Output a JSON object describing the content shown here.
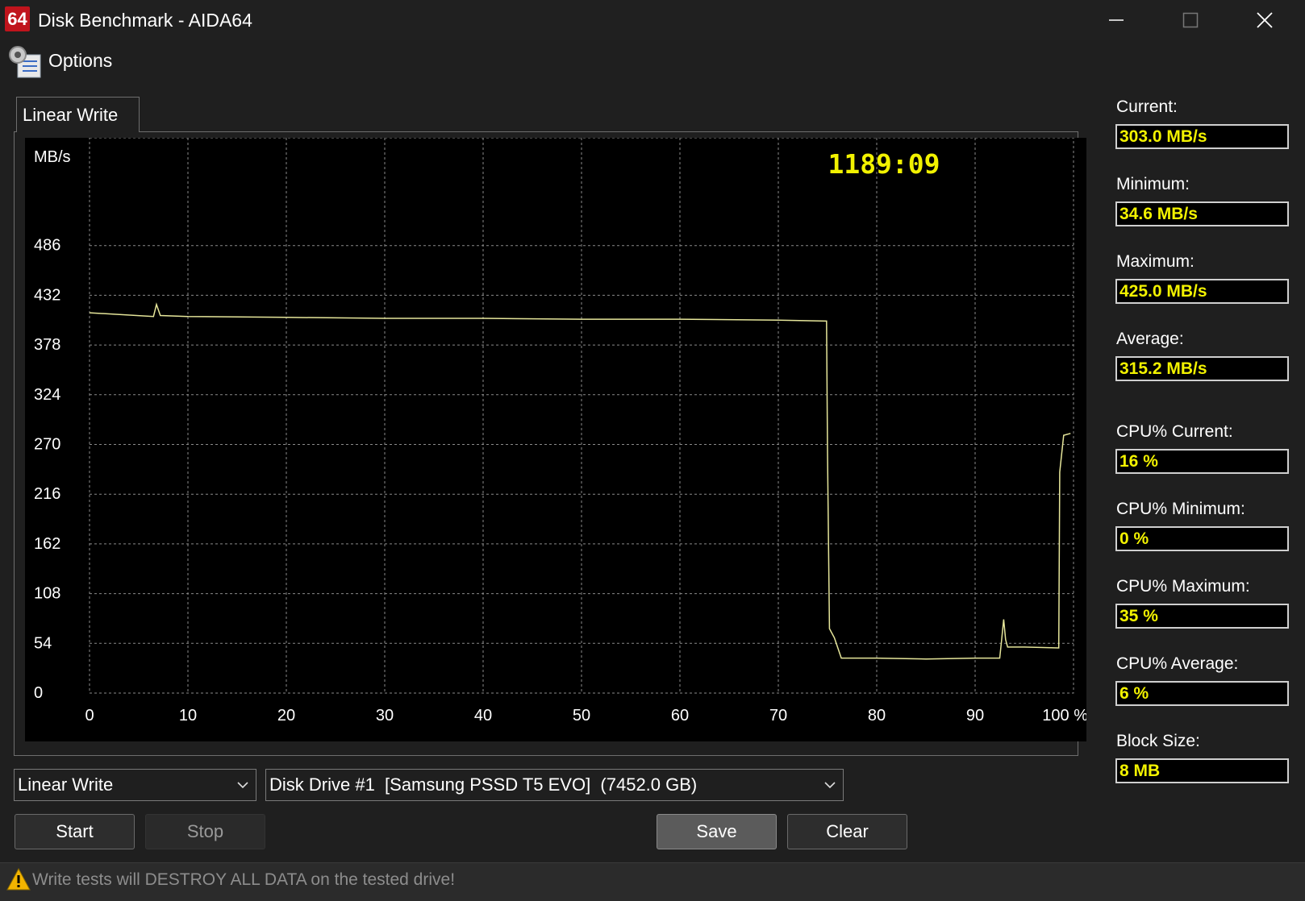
{
  "window": {
    "title": "Disk Benchmark - AIDA64",
    "logo_text": "64"
  },
  "menu": {
    "options_label": "Options"
  },
  "tabs": [
    {
      "label": "Linear Write"
    }
  ],
  "chart_data": {
    "type": "line",
    "ylabel": "MB/s",
    "y_ticks": [
      "486",
      "432",
      "378",
      "324",
      "270",
      "216",
      "162",
      "108",
      "54",
      "0"
    ],
    "x_ticks": [
      "0",
      "10",
      "20",
      "30",
      "40",
      "50",
      "60",
      "70",
      "80",
      "90",
      "100 %"
    ],
    "ylim": [
      0,
      540
    ],
    "xlim": [
      0,
      100
    ],
    "grid": true,
    "timer": "1189:09",
    "colors": {
      "background": "#000000",
      "grid": "#8a8a8a",
      "line": "#e6e69a",
      "timer": "#f2f200"
    },
    "series": [
      {
        "x": [
          0,
          6.5,
          6.8,
          7.2,
          10,
          20,
          30,
          40,
          50,
          60,
          70,
          74.9,
          75.0,
          75.2,
          75.7,
          76.4,
          80,
          85,
          90,
          92.5,
          92.7,
          92.9,
          93.1,
          93.3,
          95,
          98.5,
          98.6,
          99.0,
          99.7
        ],
        "y": [
          413,
          409,
          422,
          410,
          409,
          408,
          407,
          407,
          406,
          406,
          405,
          404,
          260,
          70,
          60,
          38,
          38,
          37,
          38,
          38,
          58,
          80,
          58,
          50,
          50,
          49,
          240,
          280,
          282
        ]
      }
    ]
  },
  "stats": {
    "current_label": "Current:",
    "current_value": "303.0 MB/s",
    "minimum_label": "Minimum:",
    "minimum_value": "34.6 MB/s",
    "maximum_label": "Maximum:",
    "maximum_value": "425.0 MB/s",
    "average_label": "Average:",
    "average_value": "315.2 MB/s",
    "cpu_current_label": "CPU% Current:",
    "cpu_current_value": "16 %",
    "cpu_minimum_label": "CPU% Minimum:",
    "cpu_minimum_value": "0 %",
    "cpu_maximum_label": "CPU% Maximum:",
    "cpu_maximum_value": "35 %",
    "cpu_average_label": "CPU% Average:",
    "cpu_average_value": "6 %",
    "block_size_label": "Block Size:",
    "block_size_value": "8 MB"
  },
  "controls": {
    "test_select_value": "Linear Write",
    "drive_select_value": "Disk Drive #1  [Samsung PSSD T5 EVO]  (7452.0 GB)",
    "start_label": "Start",
    "stop_label": "Stop",
    "save_label": "Save",
    "clear_label": "Clear"
  },
  "status": {
    "warning_text": "Write tests will DESTROY ALL DATA on the tested drive!"
  }
}
